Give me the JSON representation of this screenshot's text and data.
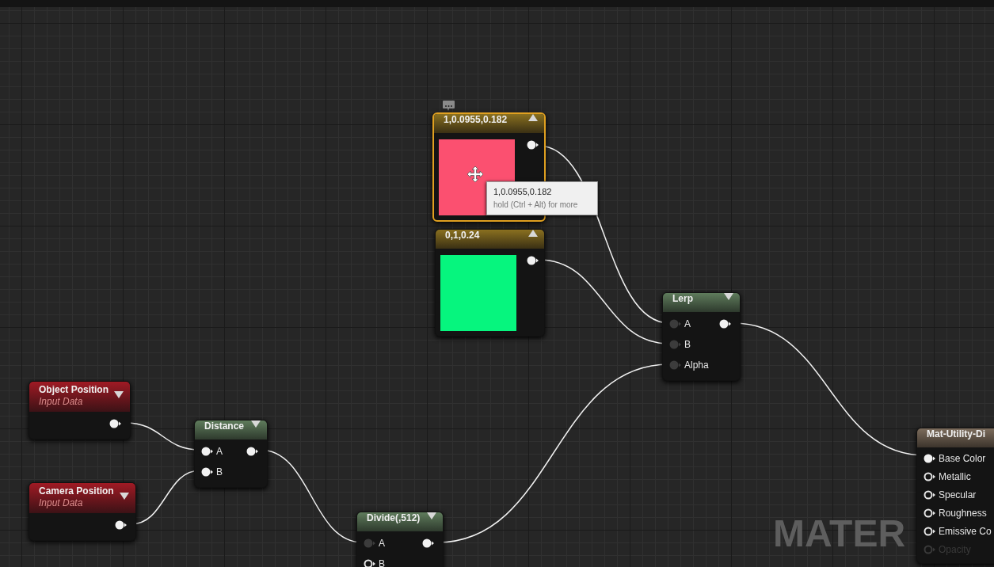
{
  "graph": {
    "watermark": "MATER"
  },
  "nodes": [
    {
      "kind": "constant",
      "title": "1,0.0955,0.182",
      "selected": true,
      "color": "#fb5070",
      "comment": true,
      "outputs": [
        {
          "kind": "filled"
        }
      ]
    },
    {
      "kind": "constant",
      "title": "0,1,0.24",
      "selected": false,
      "color": "#06f57e",
      "comment": false,
      "outputs": [
        {
          "kind": "filled"
        }
      ]
    },
    {
      "kind": "function",
      "title": "Lerp",
      "selected": false,
      "inputs": [
        {
          "label": "A",
          "kind": "dim"
        },
        {
          "label": "B",
          "kind": "dim"
        },
        {
          "label": "Alpha",
          "kind": "dim"
        }
      ],
      "outputs": [
        {
          "kind": "filled"
        }
      ]
    },
    {
      "kind": "input",
      "title": "Object Position",
      "subtitle": "Input Data",
      "selected": false,
      "outputs": [
        {
          "kind": "filled"
        }
      ]
    },
    {
      "kind": "input",
      "title": "Camera Position",
      "subtitle": "Input Data",
      "selected": false,
      "outputs": [
        {
          "kind": "filled"
        }
      ]
    },
    {
      "kind": "function",
      "title": "Distance",
      "selected": false,
      "inputs": [
        {
          "label": "A",
          "kind": "filled"
        },
        {
          "label": "B",
          "kind": "filled"
        }
      ],
      "outputs": [
        {
          "kind": "filled"
        }
      ]
    },
    {
      "kind": "function",
      "title": "Divide(,512)",
      "selected": false,
      "inputs": [
        {
          "label": "A",
          "kind": "dim"
        },
        {
          "label": "B",
          "kind": "hollow"
        }
      ],
      "outputs": [
        {
          "kind": "filled"
        }
      ]
    },
    {
      "kind": "result",
      "title": "Mat-Utility-Di",
      "selected": false,
      "inputs": [
        {
          "label": "Base Color",
          "kind": "filled"
        },
        {
          "label": "Metallic",
          "kind": "hollow"
        },
        {
          "label": "Specular",
          "kind": "hollow"
        },
        {
          "label": "Roughness",
          "kind": "hollow"
        },
        {
          "label": "Emissive Co",
          "kind": "hollow"
        },
        {
          "label": "Opacity",
          "kind": "faded"
        }
      ]
    }
  ],
  "tooltip": {
    "title": "1,0.0955,0.182",
    "hint": "hold (Ctrl + Alt) for more"
  }
}
